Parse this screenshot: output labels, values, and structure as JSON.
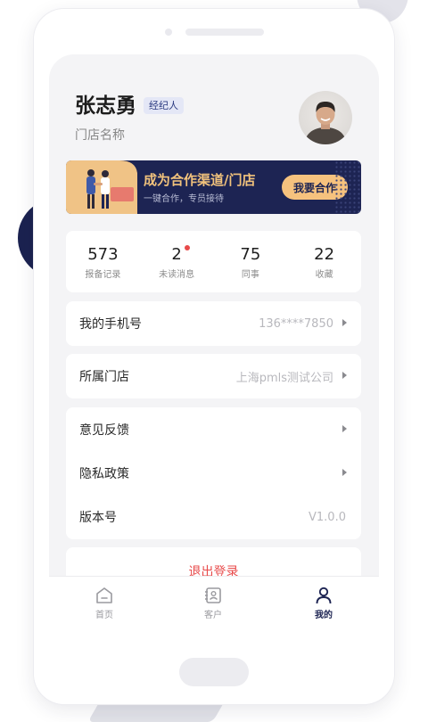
{
  "profile": {
    "name": "张志勇",
    "role_badge": "经纪人",
    "store_name": "门店名称"
  },
  "banner": {
    "title": "成为合作渠道/门店",
    "subtitle": "一键合作，专员接待",
    "button_label": "我要合作"
  },
  "stats": [
    {
      "value": "573",
      "label": "报备记录",
      "has_notification_dot": false
    },
    {
      "value": "2",
      "label": "未读消息",
      "has_notification_dot": true
    },
    {
      "value": "75",
      "label": "同事",
      "has_notification_dot": false
    },
    {
      "value": "22",
      "label": "收藏",
      "has_notification_dot": false
    }
  ],
  "info_rows": {
    "phone": {
      "label": "我的手机号",
      "value": "136****7850"
    },
    "store": {
      "label": "所属门店",
      "value": "上海pmls测试公司"
    }
  },
  "menu": {
    "feedback": {
      "label": "意见反馈"
    },
    "privacy": {
      "label": "隐私政策"
    },
    "version": {
      "label": "版本号",
      "value": "V1.0.0"
    }
  },
  "logout_label": "退出登录",
  "tabbar": {
    "items": [
      {
        "label": "首页",
        "icon": "home-icon",
        "active": false
      },
      {
        "label": "客户",
        "icon": "contacts-icon",
        "active": false
      },
      {
        "label": "我的",
        "icon": "person-icon",
        "active": true
      }
    ]
  },
  "colors": {
    "brand_navy": "#1d2453",
    "accent_orange": "#f6c27e",
    "logout_red": "#e84a4a",
    "background": "#f4f4f6"
  }
}
